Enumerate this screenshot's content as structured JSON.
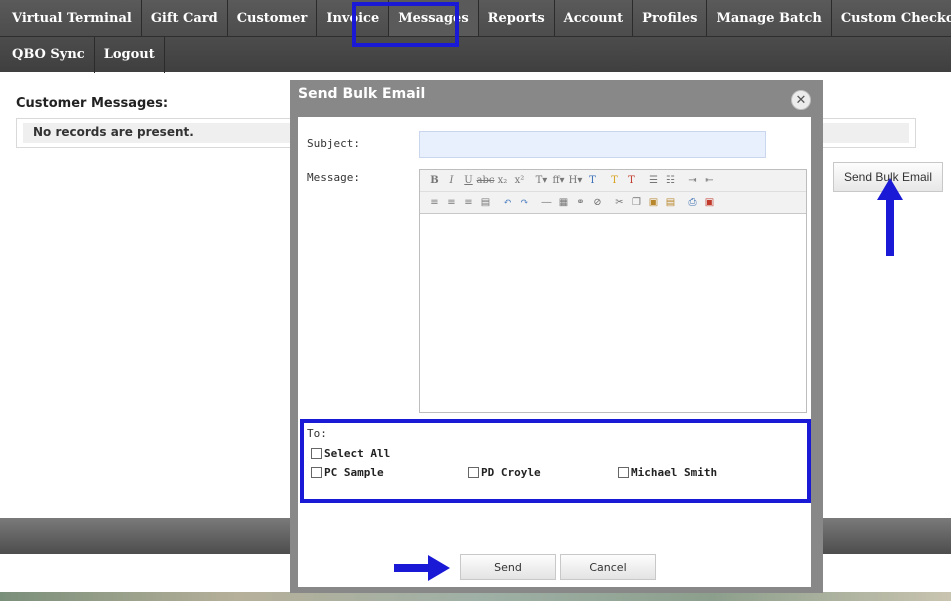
{
  "nav": {
    "row1": [
      "Virtual Terminal",
      "Gift Card",
      "Customer",
      "Invoice",
      "Messages",
      "Reports",
      "Account",
      "Profiles",
      "Manage Batch",
      "Custom Checkout"
    ],
    "row2": [
      "QBO Sync",
      "Logout"
    ],
    "active": "Messages"
  },
  "page": {
    "title": "Customer Messages:",
    "empty_text": "No records are present.",
    "bulk_button": "Send Bulk Email"
  },
  "modal": {
    "title": "Send Bulk Email",
    "close_icon": "close-icon",
    "subject_label": "Subject:",
    "subject_value": "",
    "message_label": "Message:",
    "to_label": "To:",
    "select_all": "Select All",
    "recipients": [
      "PC Sample",
      "PD Croyle",
      "Michael Smith"
    ],
    "send_button": "Send",
    "cancel_button": "Cancel"
  },
  "toolbar": {
    "row1": [
      "bold-icon",
      "italic-icon",
      "underline-icon",
      "strikethrough-icon",
      "subscript-icon",
      "superscript-icon",
      "font-size-icon",
      "font-family-icon",
      "heading-icon",
      "text-color-icon",
      "highlight-color-icon",
      "clear-format-icon",
      "bullet-list-icon",
      "numbered-list-icon",
      "indent-icon",
      "outdent-icon"
    ],
    "row2": [
      "align-left-icon",
      "align-center-icon",
      "align-right-icon",
      "justify-icon",
      "undo-icon",
      "redo-icon",
      "horizontal-rule-icon",
      "table-icon",
      "link-icon",
      "unlink-icon",
      "cut-icon",
      "copy-icon",
      "paste-icon",
      "paste-text-icon",
      "print-icon",
      "source-icon"
    ]
  },
  "colors": {
    "annotation_blue": "#1a1ad6",
    "nav_bg": "#4a4a4a",
    "modal_frame": "#888888",
    "subject_bg": "#e8f0fe"
  }
}
